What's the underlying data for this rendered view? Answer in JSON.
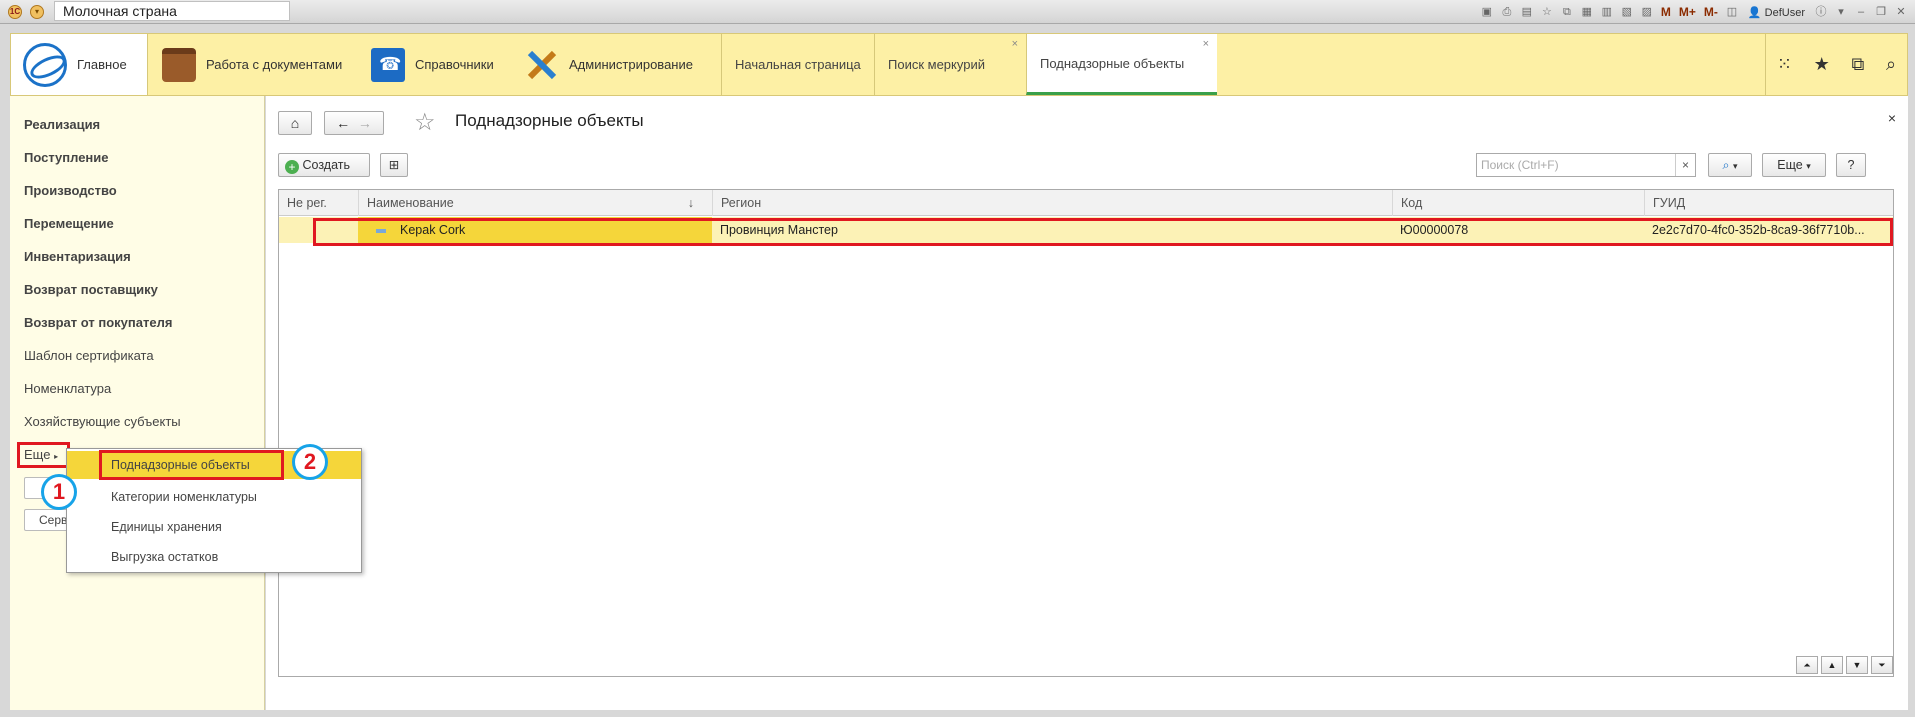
{
  "window": {
    "title": "Молочная страна",
    "user": "DefUser",
    "toolbar_m_labels": [
      "M",
      "M+",
      "M-"
    ]
  },
  "sections": {
    "main_label": "Главное",
    "items": [
      {
        "label": "Работа с документами",
        "icon": "briefcase-icon"
      },
      {
        "label": "Справочники",
        "icon": "phonebook-icon"
      },
      {
        "label": "Администрирование",
        "icon": "tools-icon"
      }
    ],
    "open_tabs": [
      {
        "label": "Начальная страница",
        "closable": false,
        "active": false
      },
      {
        "label": "Поиск меркурий",
        "closable": true,
        "active": false
      },
      {
        "label": "Поднадзорные объекты",
        "closable": true,
        "active": true
      }
    ]
  },
  "leftnav": {
    "items": [
      {
        "label": "Реализация",
        "bold": true
      },
      {
        "label": "Поступление",
        "bold": true
      },
      {
        "label": "Производство",
        "bold": true
      },
      {
        "label": "Перемещение",
        "bold": true
      },
      {
        "label": "Инвентаризация",
        "bold": true
      },
      {
        "label": "Возврат поставщику",
        "bold": true
      },
      {
        "label": "Возврат от покупателя",
        "bold": true
      },
      {
        "label": "Шаблон сертификата",
        "bold": false
      },
      {
        "label": "Номенклатура",
        "bold": false
      },
      {
        "label": "Хозяйствующие субъекты",
        "bold": false
      }
    ],
    "more_label": "Еще",
    "stub_button_label": "Серв"
  },
  "popup": {
    "items": [
      "Поднадзорные объекты",
      "Категории номенклатуры",
      "Единицы хранения",
      "Выгрузка остатков"
    ]
  },
  "markers": [
    "1",
    "2"
  ],
  "content": {
    "title": "Поднадзорные объекты",
    "create_label": "Создать",
    "search_placeholder": "Поиск (Ctrl+F)",
    "more_label": "Еще",
    "help_label": "?",
    "table": {
      "columns": [
        "Не рег.",
        "Наименование",
        "Регион",
        "Код",
        "ГУИД"
      ],
      "rows": [
        {
          "not_reg": "",
          "name": "Kepak Cork",
          "region": "Провинция Манстер",
          "code": "Ю00000078",
          "guid": "2e2c7d70-4fc0-352b-8ca9-36f7710b..."
        }
      ]
    }
  }
}
